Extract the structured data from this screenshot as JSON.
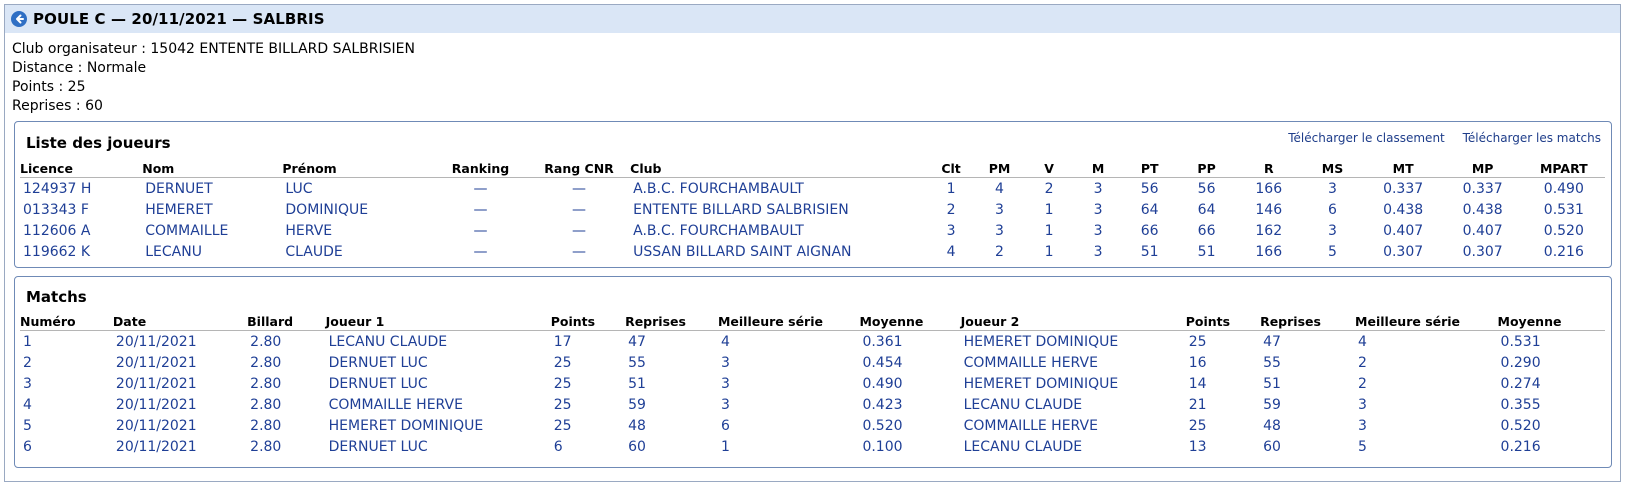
{
  "header": {
    "title": "POULE C — 20/11/2021 — SALBRIS"
  },
  "info": {
    "club": "Club organisateur : 15042 ENTENTE BILLARD SALBRISIEN",
    "distance": "Distance : Normale",
    "points": "Points : 25",
    "reprises": "Reprises : 60"
  },
  "joueurs": {
    "title": "Liste des joueurs",
    "download_ranking": "Télécharger le classement",
    "download_matches": "Télécharger les matchs",
    "columns": [
      "Licence",
      "Nom",
      "Prénom",
      "Ranking",
      "Rang CNR",
      "Club",
      "Clt",
      "PM",
      "V",
      "M",
      "PT",
      "PP",
      "R",
      "MS",
      "MT",
      "MP",
      "MPART"
    ],
    "rows": [
      [
        "124937 H",
        "DERNUET",
        "LUC",
        "—",
        "—",
        "A.B.C. FOURCHAMBAULT",
        "1",
        "4",
        "2",
        "3",
        "56",
        "56",
        "166",
        "3",
        "0.337",
        "0.337",
        "0.490"
      ],
      [
        "013343 F",
        "HEMERET",
        "DOMINIQUE",
        "—",
        "—",
        "ENTENTE BILLARD SALBRISIEN",
        "2",
        "3",
        "1",
        "3",
        "64",
        "64",
        "146",
        "6",
        "0.438",
        "0.438",
        "0.531"
      ],
      [
        "112606 A",
        "COMMAILLE",
        "HERVE",
        "—",
        "—",
        "A.B.C. FOURCHAMBAULT",
        "3",
        "3",
        "1",
        "3",
        "66",
        "66",
        "162",
        "3",
        "0.407",
        "0.407",
        "0.520"
      ],
      [
        "119662 K",
        "LECANU",
        "CLAUDE",
        "—",
        "—",
        "USSAN BILLARD SAINT AIGNAN",
        "4",
        "2",
        "1",
        "3",
        "51",
        "51",
        "166",
        "5",
        "0.307",
        "0.307",
        "0.216"
      ]
    ]
  },
  "matchs": {
    "title": "Matchs",
    "columns": [
      "Numéro",
      "Date",
      "Billard",
      "Joueur 1",
      "Points",
      "Reprises",
      "Meilleure série",
      "Moyenne",
      "Joueur 2",
      "Points",
      "Reprises",
      "Meilleure série",
      "Moyenne"
    ],
    "rows": [
      [
        "1",
        "20/11/2021",
        "2.80",
        "LECANU CLAUDE",
        "17",
        "47",
        "4",
        "0.361",
        "HEMERET DOMINIQUE",
        "25",
        "47",
        "4",
        "0.531"
      ],
      [
        "2",
        "20/11/2021",
        "2.80",
        "DERNUET LUC",
        "25",
        "55",
        "3",
        "0.454",
        "COMMAILLE HERVE",
        "16",
        "55",
        "2",
        "0.290"
      ],
      [
        "3",
        "20/11/2021",
        "2.80",
        "DERNUET LUC",
        "25",
        "51",
        "3",
        "0.490",
        "HEMERET DOMINIQUE",
        "14",
        "51",
        "2",
        "0.274"
      ],
      [
        "4",
        "20/11/2021",
        "2.80",
        "COMMAILLE HERVE",
        "25",
        "59",
        "3",
        "0.423",
        "LECANU CLAUDE",
        "21",
        "59",
        "3",
        "0.355"
      ],
      [
        "5",
        "20/11/2021",
        "2.80",
        "HEMERET DOMINIQUE",
        "25",
        "48",
        "6",
        "0.520",
        "COMMAILLE HERVE",
        "25",
        "48",
        "3",
        "0.520"
      ],
      [
        "6",
        "20/11/2021",
        "2.80",
        "DERNUET LUC",
        "6",
        "60",
        "1",
        "0.100",
        "LECANU CLAUDE",
        "13",
        "60",
        "5",
        "0.216"
      ]
    ]
  },
  "colors": {
    "title_bar_bg": "#dae6f6",
    "value_text": "#1f3f96",
    "panel_border": "#6f8ab6",
    "back_icon": "#2f6fc4"
  }
}
